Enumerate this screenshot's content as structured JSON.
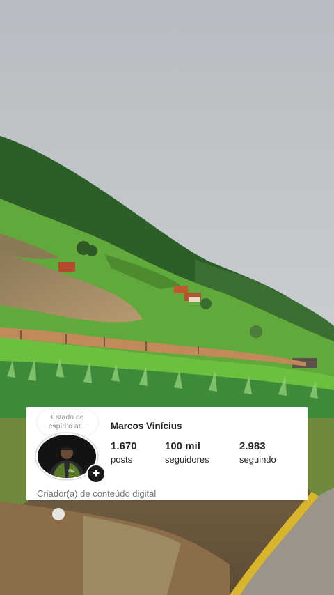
{
  "profile": {
    "note": "Estado de espírito at...",
    "username": "Marcos Vinícius",
    "category": "Criador(a) de conteúdo digital",
    "add_symbol": "+",
    "stats": {
      "posts": {
        "value": "1.670",
        "label": "posts"
      },
      "followers": {
        "value": "100 mil",
        "label": "seguidores"
      },
      "following": {
        "value": "2.983",
        "label": "seguindo"
      }
    }
  },
  "colors": {
    "sky": "#c3c9ce",
    "hill": "#2f6a2a",
    "field": "#5fa83a",
    "pond": "#a78a62",
    "road": "#8e8a83",
    "curb": "#d6b52a"
  }
}
